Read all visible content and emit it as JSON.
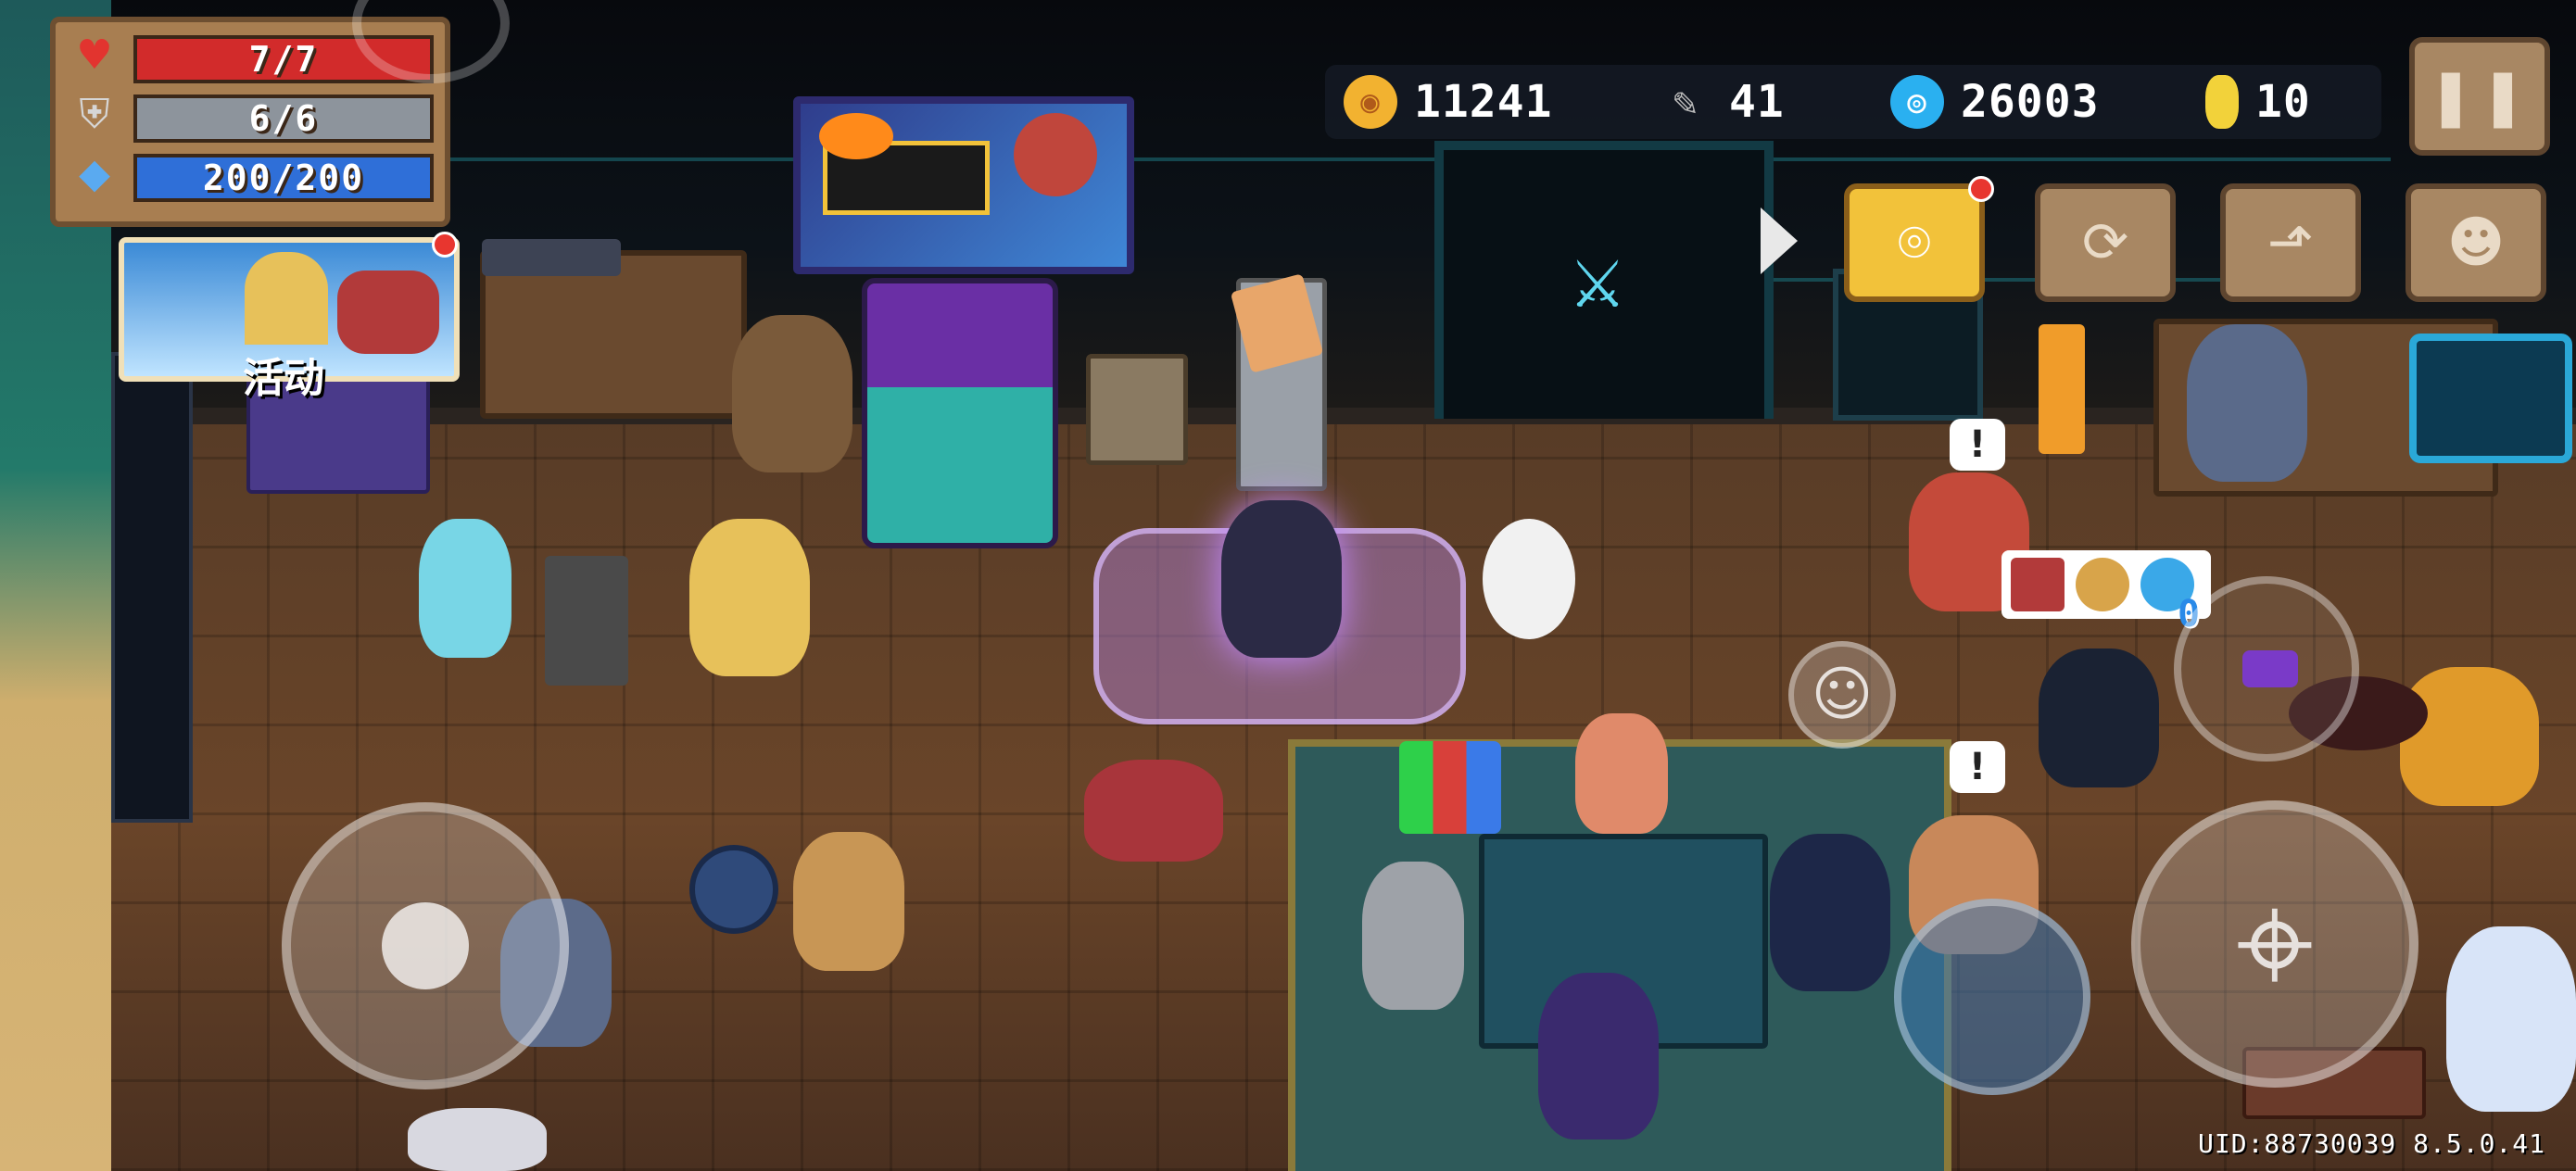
{
  "hud": {
    "hp": "7/7",
    "armor": "6/6",
    "energy": "200/200",
    "hp_icon": "heart-icon",
    "armor_icon": "shield-icon",
    "energy_icon": "diamond-icon"
  },
  "currency": {
    "gold": "11241",
    "feathers": "41",
    "gems": "26003",
    "tokens": "10"
  },
  "event": {
    "label": "活动"
  },
  "buttons": {
    "pause_icon": "pause-icon",
    "location_icon": "location-pin-icon",
    "refresh_icon": "refresh-icon",
    "chart_icon": "stairs-icon",
    "profile_icon": "profile-card-icon",
    "emote_icon": "smiley-icon",
    "aim_icon": "crosshair-icon",
    "weapon_swap_icon": "swap-icon"
  },
  "status_bubble": {
    "count": "0"
  },
  "footer": {
    "uid": "UID:88730039 8.5.0.41"
  },
  "colors": {
    "hp": "#d22b2b",
    "armor": "#8d949c",
    "energy": "#2f6fd8",
    "gold_button": "#f2c23a",
    "panel_wood": "#a87e51"
  }
}
